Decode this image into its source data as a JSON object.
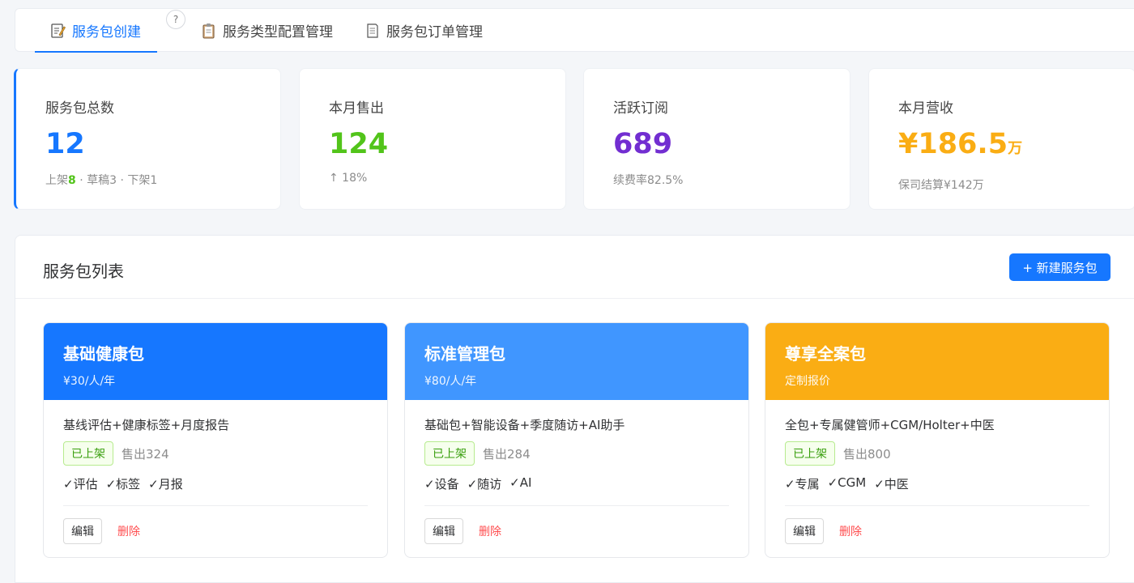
{
  "tabs": [
    {
      "label": "服务包创建",
      "icon": "edit-note-icon",
      "active": true
    },
    {
      "label": "服务类型配置管理",
      "icon": "clipboard-icon",
      "active": false
    },
    {
      "label": "服务包订单管理",
      "icon": "document-icon",
      "active": false
    }
  ],
  "help_label": "?",
  "stats": [
    {
      "label": "服务包总数",
      "value": "12",
      "color": "#1677ff",
      "sub": {
        "prefix": "上架",
        "highlight": "8",
        "rest": " · 草稿3 · 下架1"
      }
    },
    {
      "label": "本月售出",
      "value": "124",
      "color": "#52c41a",
      "sub_text": "↑ 18%"
    },
    {
      "label": "活跃订阅",
      "value": "689",
      "color": "#722ed1",
      "sub_text": "续费率82.5%"
    },
    {
      "label": "本月营收",
      "value": "¥186.5",
      "unit": "万",
      "color": "#faad14",
      "sub_text": "保司结算¥142万"
    }
  ],
  "list": {
    "title": "服务包列表",
    "new_button": "+ 新建服务包",
    "packages": [
      {
        "name": "基础健康包",
        "price": "¥30/人/年",
        "color": "#1677ff",
        "desc": "基线评估+健康标签+月度报告",
        "status": "已上架",
        "sold": "售出324",
        "features": [
          "✓评估",
          "✓标签",
          "✓月报"
        ],
        "edit": "编辑",
        "delete": "删除"
      },
      {
        "name": "标准管理包",
        "price": "¥80/人/年",
        "color": "#4096ff",
        "desc": "基础包+智能设备+季度随访+AI助手",
        "status": "已上架",
        "sold": "售出284",
        "features": [
          "✓设备",
          "✓随访",
          "✓AI"
        ],
        "edit": "编辑",
        "delete": "删除"
      },
      {
        "name": "尊享全案包",
        "price": "定制报价",
        "color": "#faad14",
        "desc": "全包+专属健管师+CGM/Holter+中医",
        "status": "已上架",
        "sold": "售出800",
        "features": [
          "✓专属",
          "✓CGM",
          "✓中医"
        ],
        "edit": "编辑",
        "delete": "删除"
      }
    ]
  }
}
